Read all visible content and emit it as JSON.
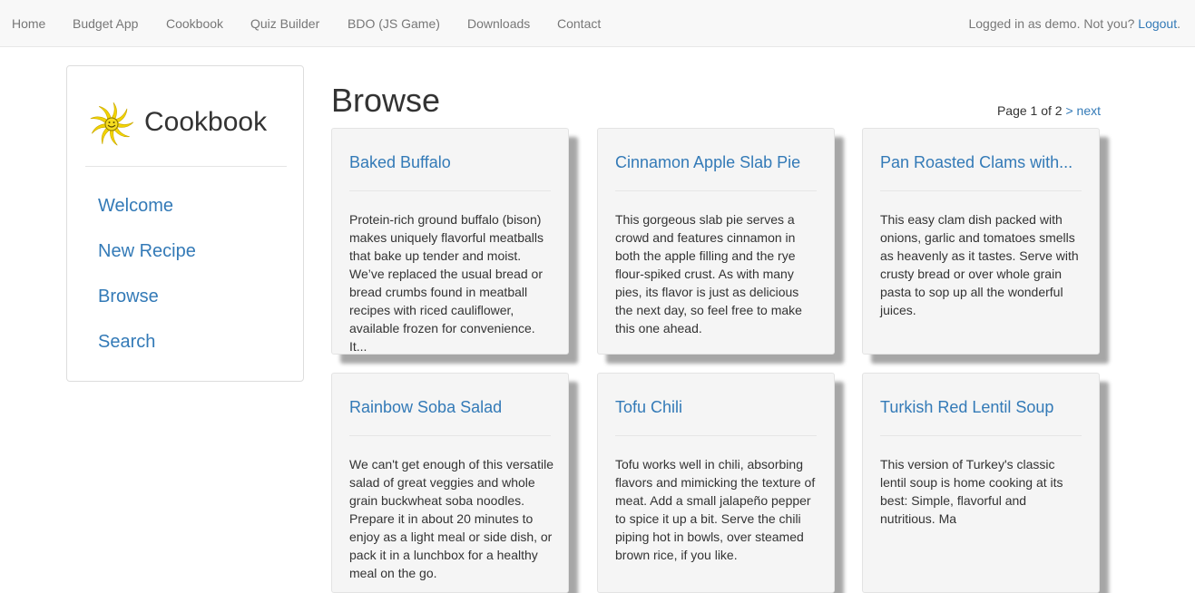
{
  "navbar": {
    "links": [
      "Home",
      "Budget App",
      "Cookbook",
      "Quiz Builder",
      "BDO (JS Game)",
      "Downloads",
      "Contact"
    ],
    "login_text": "Logged in as demo. Not you? ",
    "logout_label": "Logout",
    "logout_suffix": "."
  },
  "sidebar": {
    "brand_title": "Cookbook",
    "logo_icon": "sun-icon",
    "items": [
      "Welcome",
      "New Recipe",
      "Browse",
      "Search"
    ]
  },
  "main": {
    "title": "Browse",
    "pager_text": "Page 1 of 2 ",
    "pager_next": "> next",
    "recipes": [
      {
        "title": "Baked Buffalo",
        "description": "Protein-rich ground buffalo (bison) makes uniquely flavorful meatballs that bake up tender and moist. We’ve replaced the usual bread or bread crumbs found in meatball recipes with riced cauliflower, available frozen for convenience. It..."
      },
      {
        "title": "Cinnamon Apple Slab Pie",
        "description": "This gorgeous slab pie serves a crowd and features cinnamon in both the apple filling and the rye flour-spiked crust. As with many pies, its flavor is just as delicious the next day, so feel free to make this one ahead."
      },
      {
        "title": "Pan Roasted Clams with...",
        "description": "This easy clam dish packed with onions, garlic and tomatoes smells as heavenly as it tastes. Serve with crusty bread or over whole grain pasta to sop up all the wonderful juices."
      },
      {
        "title": "Rainbow Soba Salad",
        "description": "We can't get enough of this versatile salad of great veggies and whole grain buckwheat soba noodles. Prepare it in about 20 minutes to enjoy as a light meal or side dish, or pack it in a lunchbox for a healthy meal on the go."
      },
      {
        "title": "Tofu Chili",
        "description": "Tofu works well in chili, absorbing flavors and mimicking the texture of meat. Add a small jalapeño pepper to spice it up a bit. Serve the chili piping hot in bowls, over steamed brown rice, if you like."
      },
      {
        "title": "Turkish Red Lentil Soup",
        "description": "This version of Turkey's classic lentil soup is home cooking at its best: Simple, flavorful and nutritious. Ma"
      }
    ]
  },
  "colors": {
    "link": "#337ab7",
    "navbar_bg": "#f8f8f8",
    "card_bg": "#f5f5f5",
    "logo_yellow": "#f2d400"
  }
}
